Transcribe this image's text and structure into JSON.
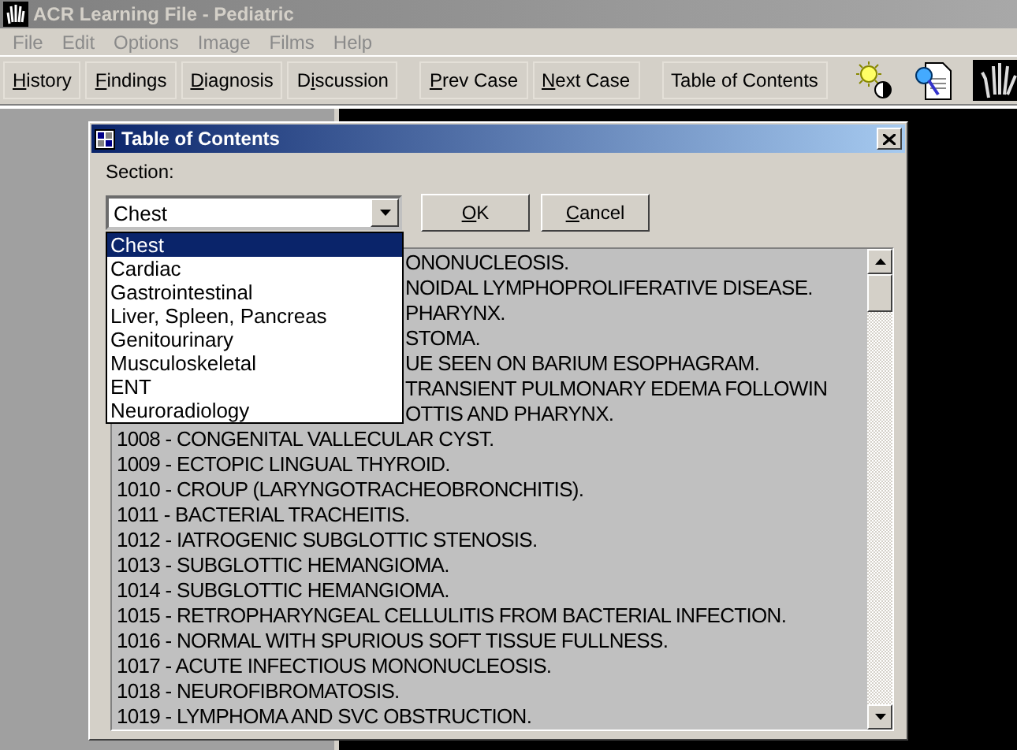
{
  "window": {
    "title": "ACR Learning File - Pediatric"
  },
  "menu": [
    {
      "label": "File",
      "disabled": true
    },
    {
      "label": "Edit",
      "disabled": true
    },
    {
      "label": "Options",
      "disabled": true
    },
    {
      "label": "Image",
      "disabled": true
    },
    {
      "label": "Films",
      "disabled": true
    },
    {
      "label": "Help",
      "disabled": true
    }
  ],
  "toolbar": {
    "groups": [
      [
        {
          "underlined": "H",
          "rest": "istory"
        },
        {
          "underlined": "F",
          "rest": "indings"
        },
        {
          "underlined": "D",
          "rest": "iagnosis"
        },
        {
          "before": "D",
          "underlined": "i",
          "rest": "scussion"
        }
      ],
      [
        {
          "underlined": "P",
          "rest": "rev Case"
        },
        {
          "underlined": "N",
          "rest": "ext Case"
        }
      ],
      [
        {
          "label": "Table of Contents"
        }
      ]
    ],
    "icons": [
      {
        "kind": "brightness"
      },
      {
        "kind": "document-search"
      },
      {
        "kind": "hand"
      }
    ]
  },
  "dialog": {
    "title": "Table of Contents",
    "section_label": "Section:",
    "section_value": "Chest",
    "buttons": [
      {
        "underlined": "O",
        "rest": "K"
      },
      {
        "underlined": "C",
        "rest": "ancel"
      }
    ],
    "dropdown": {
      "expanded": true,
      "options": [
        {
          "label": "Chest",
          "selected": true
        },
        {
          "label": "Cardiac",
          "selected": false
        },
        {
          "label": "Gastrointestinal",
          "selected": false
        },
        {
          "label": "Liver, Spleen, Pancreas",
          "selected": false
        },
        {
          "label": "Genitourinary",
          "selected": false
        },
        {
          "label": "Musculoskeletal",
          "selected": false
        },
        {
          "label": "ENT",
          "selected": false
        },
        {
          "label": "Neuroradiology",
          "selected": false
        }
      ]
    },
    "cases": [
      {
        "text": "ONONUCLEOSIS.",
        "kind": "partial"
      },
      {
        "text": "NOIDAL LYMPHOPROLIFERATIVE DISEASE.",
        "kind": "partial"
      },
      {
        "text": "PHARYNX.",
        "kind": "partial"
      },
      {
        "text": "STOMA.",
        "kind": "partial"
      },
      {
        "text": "UE SEEN ON BARIUM ESOPHAGRAM.",
        "kind": "partial"
      },
      {
        "text": "TRANSIENT PULMONARY EDEMA FOLLOWIN",
        "kind": "partial"
      },
      {
        "text": "OTTIS AND PHARYNX.",
        "kind": "partial"
      },
      {
        "text": "1008 - CONGENITAL VALLECULAR CYST.",
        "kind": "full"
      },
      {
        "text": "1009 - ECTOPIC LINGUAL THYROID.",
        "kind": "full"
      },
      {
        "text": "1010 - CROUP (LARYNGOTRACHEOBRONCHITIS).",
        "kind": "full"
      },
      {
        "text": "1011 - BACTERIAL TRACHEITIS.",
        "kind": "full"
      },
      {
        "text": "1012 - IATROGENIC SUBGLOTTIC STENOSIS.",
        "kind": "full"
      },
      {
        "text": "1013 - SUBGLOTTIC HEMANGIOMA.",
        "kind": "full"
      },
      {
        "text": "1014 - SUBGLOTTIC HEMANGIOMA.",
        "kind": "full"
      },
      {
        "text": "1015 - RETROPHARYNGEAL CELLULITIS FROM BACTERIAL INFECTION.",
        "kind": "full"
      },
      {
        "text": "1016 - NORMAL WITH SPURIOUS SOFT TISSUE FULLNESS.",
        "kind": "full"
      },
      {
        "text": "1017 - ACUTE INFECTIOUS MONONUCLEOSIS.",
        "kind": "full"
      },
      {
        "text": "1018 - NEUROFIBROMATOSIS.",
        "kind": "full"
      },
      {
        "text": "1019 - LYMPHOMA AND SVC OBSTRUCTION.",
        "kind": "full"
      }
    ]
  }
}
